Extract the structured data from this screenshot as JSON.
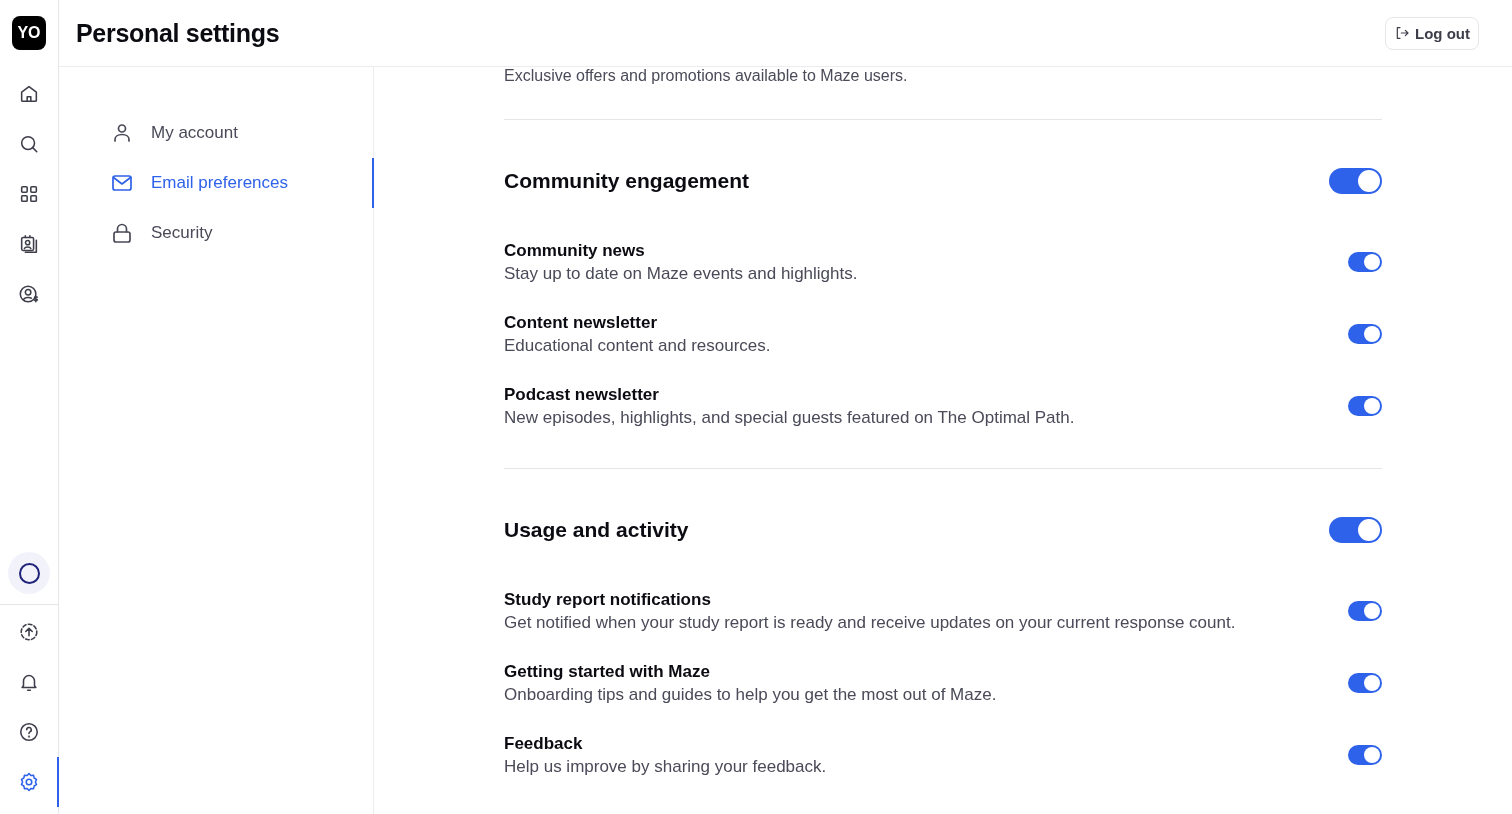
{
  "rail": {
    "logo": "YO",
    "top": [
      {
        "kind": "home",
        "selected": false
      },
      {
        "kind": "search",
        "selected": false
      },
      {
        "kind": "grid",
        "selected": false
      },
      {
        "kind": "contacts",
        "selected": false
      },
      {
        "kind": "billing",
        "selected": false
      }
    ],
    "bottom": [
      {
        "kind": "upload",
        "selected": false
      },
      {
        "kind": "bell",
        "selected": false
      },
      {
        "kind": "help",
        "selected": false
      },
      {
        "kind": "settings",
        "selected": true
      }
    ]
  },
  "header": {
    "title": "Personal settings",
    "logout": "Log out"
  },
  "menu": [
    {
      "kind": "user",
      "label": "My account",
      "selected": false
    },
    {
      "kind": "mail",
      "label": "Email preferences",
      "selected": true
    },
    {
      "kind": "lock",
      "label": "Security",
      "selected": false
    }
  ],
  "top_note": "Exclusive offers and promotions available to Maze users.",
  "sections": [
    {
      "title": "Community engagement",
      "on": true,
      "items": [
        {
          "title": "Community news",
          "description": "Stay up to date on Maze events and highlights.",
          "on": true
        },
        {
          "title": "Content newsletter",
          "description": "Educational content and resources.",
          "on": true
        },
        {
          "title": "Podcast newsletter",
          "description": "New episodes, highlights, and special guests featured on The Optimal Path.",
          "on": true
        }
      ]
    },
    {
      "title": "Usage and activity",
      "on": true,
      "items": [
        {
          "title": "Study report notifications",
          "description": "Get notified when your study report is ready and receive updates on your current response count.",
          "on": true
        },
        {
          "title": "Getting started with Maze",
          "description": "Onboarding tips and guides to help you get the most out of Maze.",
          "on": true
        },
        {
          "title": "Feedback",
          "description": "Help us improve by sharing your feedback.",
          "on": true
        }
      ]
    }
  ]
}
